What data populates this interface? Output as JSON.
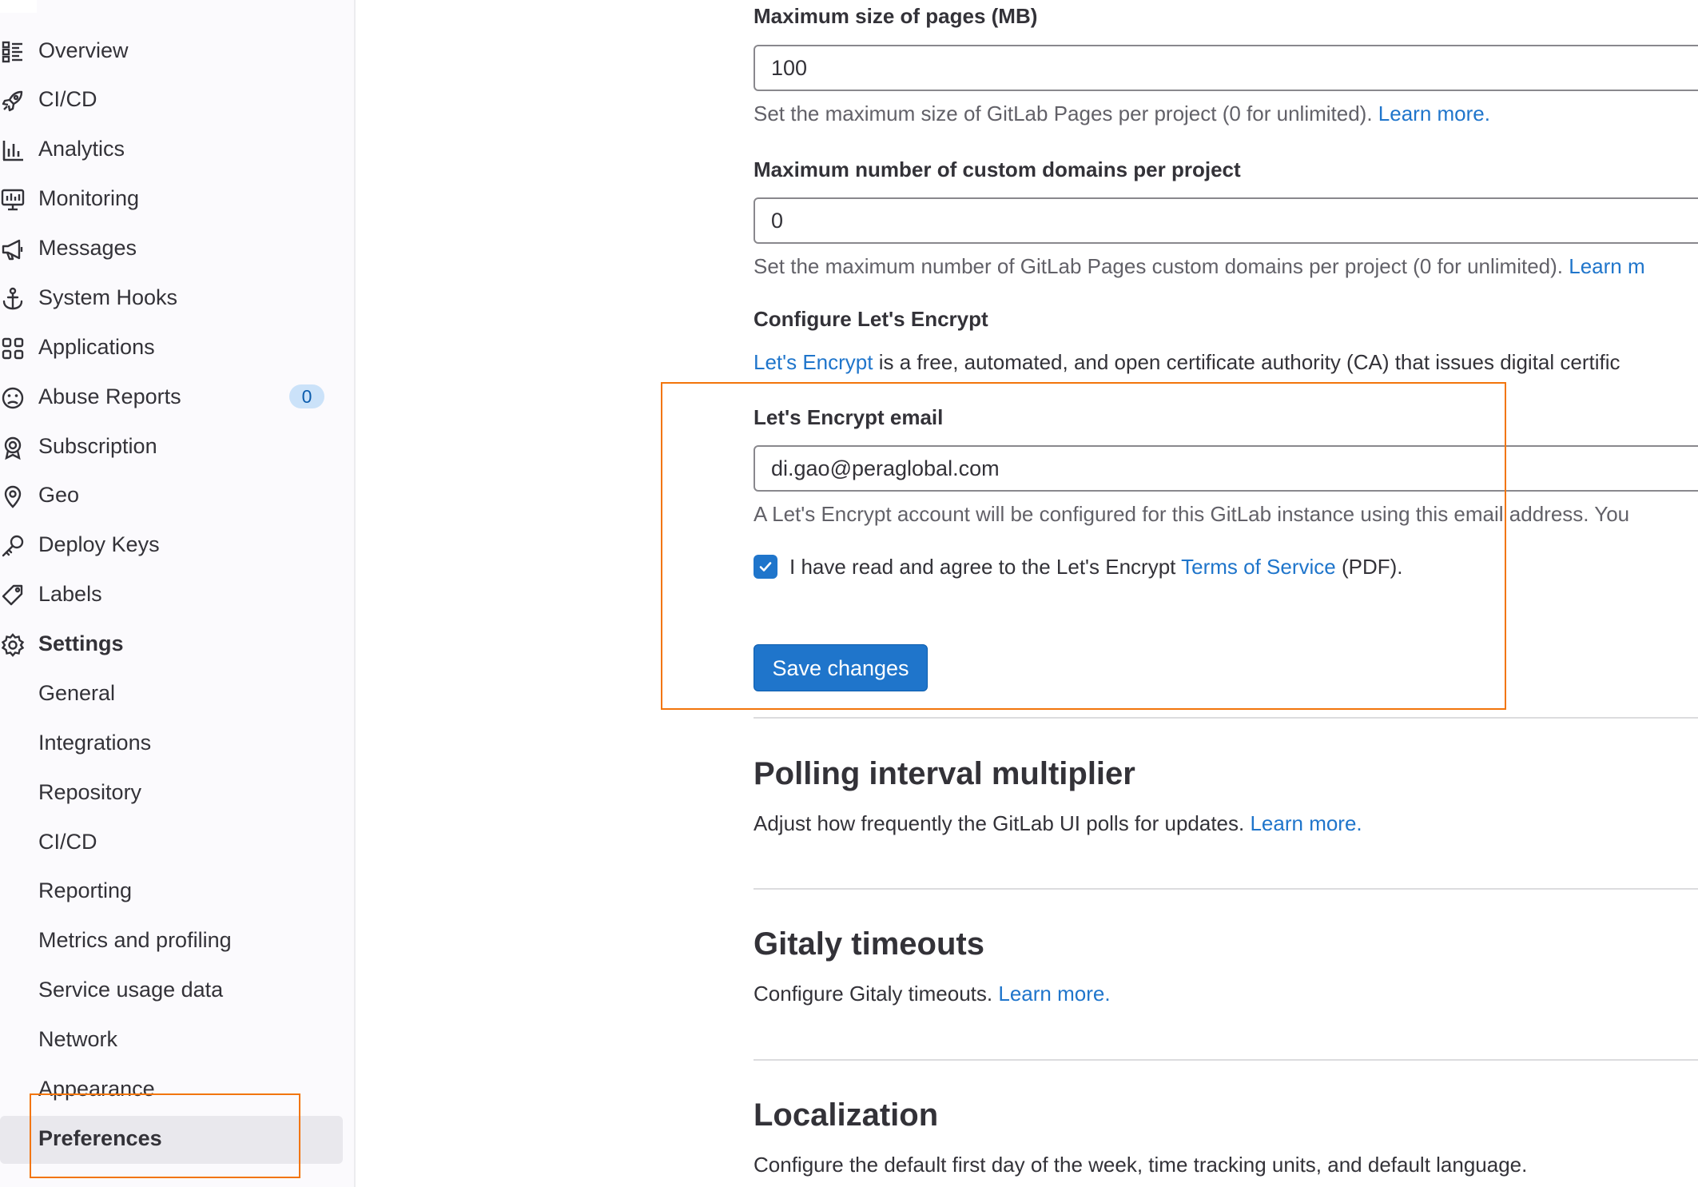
{
  "sidebar": {
    "items": [
      {
        "label": "Overview",
        "icon": "overview-icon"
      },
      {
        "label": "CI/CD",
        "icon": "rocket-icon"
      },
      {
        "label": "Analytics",
        "icon": "chart-icon"
      },
      {
        "label": "Monitoring",
        "icon": "monitor-icon"
      },
      {
        "label": "Messages",
        "icon": "bullhorn-icon"
      },
      {
        "label": "System Hooks",
        "icon": "anchor-icon"
      },
      {
        "label": "Applications",
        "icon": "applications-icon"
      },
      {
        "label": "Abuse Reports",
        "icon": "abuse-face-icon",
        "badge": "0"
      },
      {
        "label": "Subscription",
        "icon": "license-icon"
      },
      {
        "label": "Geo",
        "icon": "location-icon"
      },
      {
        "label": "Deploy Keys",
        "icon": "key-icon"
      },
      {
        "label": "Labels",
        "icon": "labels-icon"
      },
      {
        "label": "Settings",
        "icon": "settings-icon"
      }
    ],
    "settings_subitems": [
      "General",
      "Integrations",
      "Repository",
      "CI/CD",
      "Reporting",
      "Metrics and profiling",
      "Service usage data",
      "Network",
      "Appearance",
      "Preferences"
    ],
    "active_item": "Preferences"
  },
  "pages": {
    "max_size_label": "Maximum size of pages (MB)",
    "max_size_value": "100",
    "max_size_help": "Set the maximum size of GitLab Pages per project (0 for unlimited).",
    "max_size_link": "Learn more.",
    "max_domains_label": "Maximum number of custom domains per project",
    "max_domains_value": "0",
    "max_domains_help": "Set the maximum number of GitLab Pages custom domains per project (0 for unlimited).",
    "max_domains_link": "Learn m",
    "letsencrypt_heading": "Configure Let's Encrypt",
    "letsencrypt_link": "Let's Encrypt",
    "letsencrypt_desc": " is a free, automated, and open certificate authority (CA) that issues digital certific",
    "email_label": "Let's Encrypt email",
    "email_value": "di.gao@peraglobal.com",
    "email_help": "A Let's Encrypt account will be configured for this GitLab instance using this email address. You",
    "tos_text_before": "I have read and agree to the Let's Encrypt ",
    "tos_link": "Terms of Service",
    "tos_text_after": " (PDF).",
    "tos_checked": true,
    "save_button": "Save changes"
  },
  "sections": {
    "polling_title": "Polling interval multiplier",
    "polling_desc": "Adjust how frequently the GitLab UI polls for updates. ",
    "polling_link": "Learn more.",
    "gitaly_title": "Gitaly timeouts",
    "gitaly_desc": "Configure Gitaly timeouts. ",
    "gitaly_link": "Learn more.",
    "localization_title": "Localization",
    "localization_desc": "Configure the default first day of the week, time tracking units, and default language."
  },
  "colors": {
    "link": "#1f75cb",
    "primary_button": "#1f75cb",
    "highlight_box": "#f2750b",
    "badge_bg": "#cbe2f9"
  }
}
